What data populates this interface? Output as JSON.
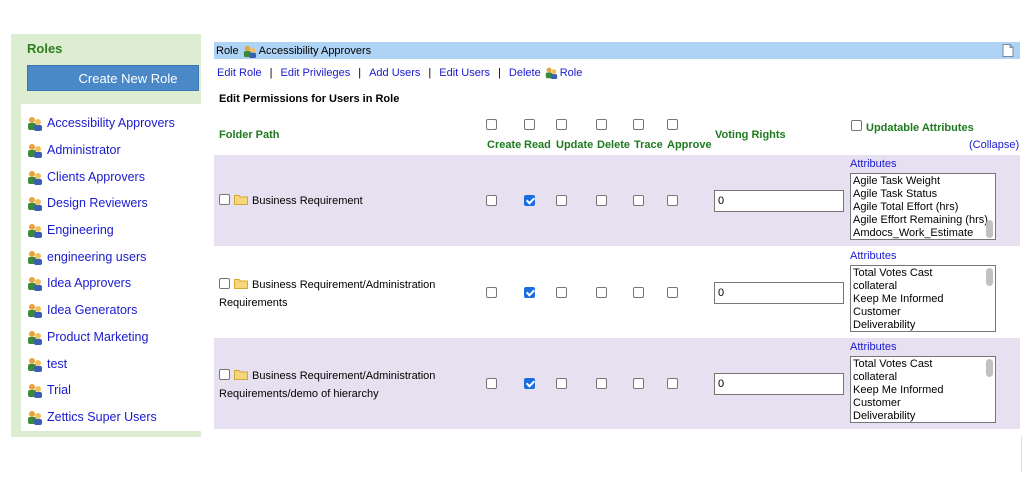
{
  "sidebar": {
    "title": "Roles",
    "create_button": "Create New Role",
    "roles": [
      "Accessibility Approvers",
      "Administrator",
      "Clients Approvers",
      "Design Reviewers",
      "Engineering",
      "engineering users",
      "Idea Approvers",
      "Idea Generators",
      "Product Marketing",
      "test",
      "Trial",
      "Zettics Super Users"
    ]
  },
  "header": {
    "prefix": "Role",
    "role_name": "Accessibility Approvers"
  },
  "tabs": {
    "edit_role": "Edit Role",
    "edit_privileges": "Edit Privileges",
    "add_users": "Add Users",
    "edit_users": "Edit Users",
    "delete": "Delete",
    "role": "Role"
  },
  "section_title": "Edit Permissions for Users in Role",
  "columns": {
    "folder_path": "Folder Path",
    "create": "Create",
    "read": "Read",
    "update": "Update",
    "delete": "Delete",
    "trace": "Trace",
    "approve": "Approve",
    "voting_rights": "Voting Rights",
    "updatable_attributes": "Updatable Attributes",
    "collapse": "(Collapse)"
  },
  "rows": [
    {
      "path_line1": "Business Requirement",
      "path_line2": "",
      "read_checked": true,
      "voting": "0",
      "attributes_label": "Attributes",
      "attributes": [
        "Agile Task Weight",
        "Agile Task Status",
        "Agile Total Effort (hrs)",
        "Agile Effort Remaining (hrs)",
        "Amdocs_Work_Estimate"
      ]
    },
    {
      "path_line1": "Business Requirement/Administration",
      "path_line2": "Requirements",
      "read_checked": true,
      "voting": "0",
      "attributes_label": "Attributes",
      "attributes": [
        "Total Votes Cast",
        "collateral",
        "Keep Me Informed",
        "Customer",
        "Deliverability"
      ]
    },
    {
      "path_line1": "Business Requirement/Administration",
      "path_line2": "Requirements/demo of hierarchy",
      "read_checked": true,
      "voting": "0",
      "attributes_label": "Attributes",
      "attributes": [
        "Total Votes Cast",
        "collateral",
        "Keep Me Informed",
        "Customer",
        "Deliverability"
      ]
    }
  ],
  "colors": {
    "sidebar_bg": "#dcedd2",
    "header_bg": "#aed3f4",
    "row_bg": "#e7e0f0",
    "link": "#1a1ad0",
    "accent_green": "#1f7a1f",
    "button_blue": "#4b88c8"
  }
}
